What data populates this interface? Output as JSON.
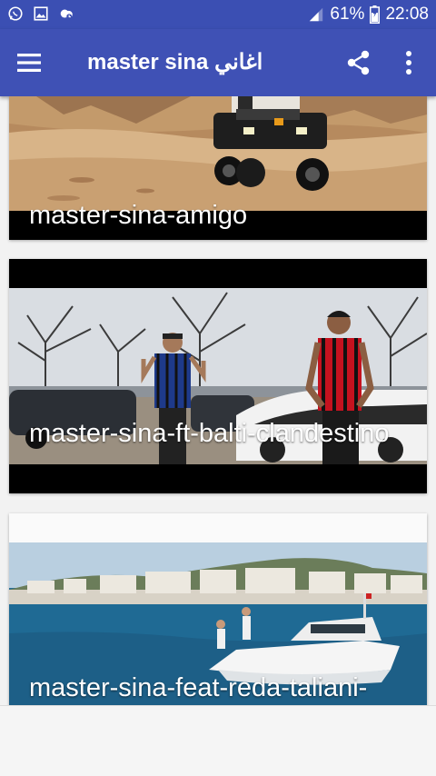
{
  "status_bar": {
    "battery": "61%",
    "time": "22:08",
    "icons": [
      "whatsapp-icon",
      "gallery-icon",
      "cloud-icon",
      "signal-icon",
      "battery-icon"
    ]
  },
  "app_bar": {
    "title": "master sina اغاني",
    "icons": [
      "menu-icon",
      "share-icon",
      "more-vert-icon"
    ],
    "color": "#3f51b5"
  },
  "videos": [
    {
      "caption": "master-sina-amigo"
    },
    {
      "caption": "master-sina-ft-balti-clandestino"
    },
    {
      "caption": "master-sina-feat-reda-taliani-"
    }
  ],
  "colors": {
    "primary": "#3f51b5",
    "status_bar": "#3b4fb3",
    "card_bg": "#000000",
    "page_bg": "#f2f2f2"
  }
}
